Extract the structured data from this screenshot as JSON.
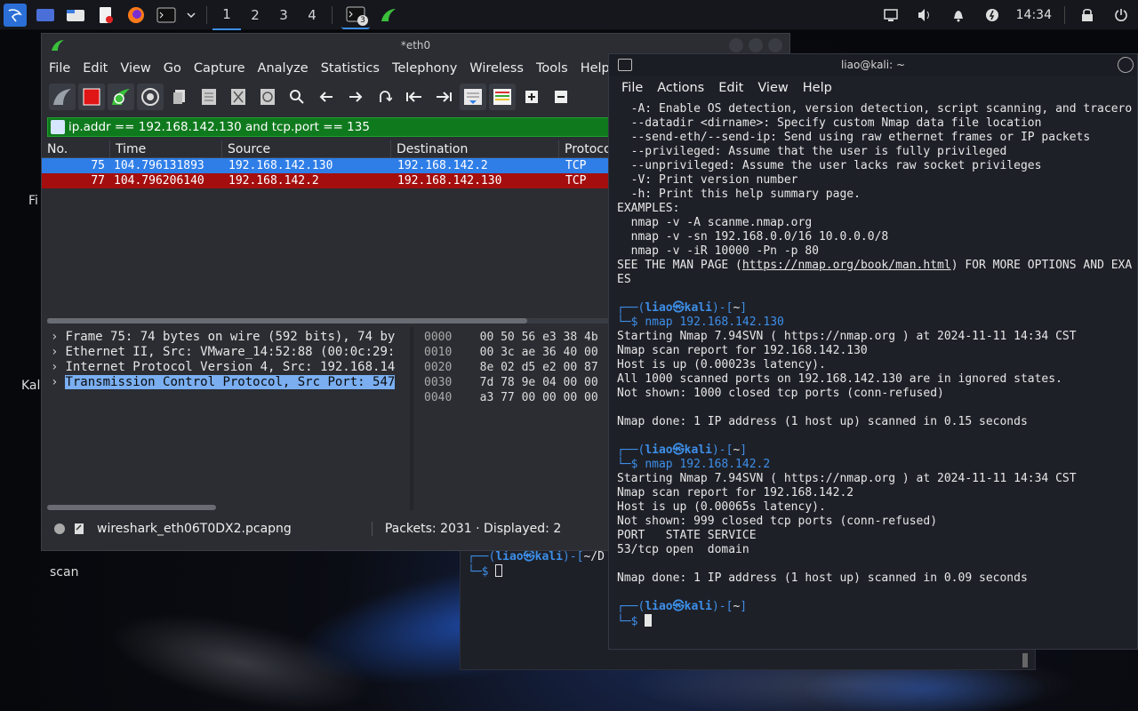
{
  "taskbar": {
    "workspaces": [
      "1",
      "2",
      "3",
      "4"
    ],
    "active_workspace": "1",
    "terminal_badge": "3",
    "clock": "14:34"
  },
  "desktop": {
    "labels": [
      "Fi",
      "Kal",
      "scan"
    ]
  },
  "wireshark": {
    "title": "*eth0",
    "menu": [
      "File",
      "Edit",
      "View",
      "Go",
      "Capture",
      "Analyze",
      "Statistics",
      "Telephony",
      "Wireless",
      "Tools",
      "Help"
    ],
    "filter": "ip.addr == 192.168.142.130 and tcp.port == 135",
    "columns": [
      "No.",
      "Time",
      "Source",
      "Destination",
      "Protocol"
    ],
    "packets": [
      {
        "no": "75",
        "time": "104.796131893",
        "src": "192.168.142.130",
        "dst": "192.168.142.2",
        "proto": "TCP"
      },
      {
        "no": "77",
        "time": "104.796206140",
        "src": "192.168.142.2",
        "dst": "192.168.142.130",
        "proto": "TCP"
      }
    ],
    "tree": [
      "Frame 75: 74 bytes on wire (592 bits), 74 by",
      "Ethernet II, Src: VMware_14:52:88 (00:0c:29:",
      "Internet Protocol Version 4, Src: 192.168.14",
      "Transmission Control Protocol, Src Port: 547"
    ],
    "hex": [
      {
        "off": "0000",
        "bytes": "00 50 56 e3 38 4b"
      },
      {
        "off": "0010",
        "bytes": "00 3c ae 36 40 00"
      },
      {
        "off": "0020",
        "bytes": "8e 02 d5 e2 00 87"
      },
      {
        "off": "0030",
        "bytes": "7d 78 9e 04 00 00"
      },
      {
        "off": "0040",
        "bytes": "a3 77 00 00 00 00"
      }
    ],
    "status_file": "wireshark_eth06T0DX2.pcapng",
    "status_packets": "Packets: 2031 · Displayed: 2"
  },
  "back_terminal": {
    "prompt_user": "liao",
    "prompt_host": "kali",
    "prompt_dir": "~/D"
  },
  "terminal": {
    "title": "liao@kali: ~",
    "menu": [
      "File",
      "Actions",
      "Edit",
      "View",
      "Help"
    ],
    "help_lines": [
      "  -A: Enable OS detection, version detection, script scanning, and tracero",
      "  --datadir <dirname>: Specify custom Nmap data file location",
      "  --send-eth/--send-ip: Send using raw ethernet frames or IP packets",
      "  --privileged: Assume that the user is fully privileged",
      "  --unprivileged: Assume the user lacks raw socket privileges",
      "  -V: Print version number",
      "  -h: Print this help summary page.",
      "EXAMPLES:",
      "  nmap -v -A scanme.nmap.org",
      "  nmap -v -sn 192.168.0.0/16 10.0.0.0/8",
      "  nmap -v -iR 10000 -Pn -p 80"
    ],
    "man_prefix": "SEE THE MAN PAGE (",
    "man_url": "https://nmap.org/book/man.html",
    "man_suffix": ") FOR MORE OPTIONS AND EXA",
    "man_wrap": "ES",
    "prompt_user": "liao",
    "prompt_host": "kali",
    "prompt_dir": "~",
    "cmd1": "nmap 192.168.142.130",
    "out1": [
      "Starting Nmap 7.94SVN ( https://nmap.org ) at 2024-11-11 14:34 CST",
      "Nmap scan report for 192.168.142.130",
      "Host is up (0.00023s latency).",
      "All 1000 scanned ports on 192.168.142.130 are in ignored states.",
      "Not shown: 1000 closed tcp ports (conn-refused)",
      "",
      "Nmap done: 1 IP address (1 host up) scanned in 0.15 seconds"
    ],
    "cmd2": "nmap 192.168.142.2",
    "out2": [
      "Starting Nmap 7.94SVN ( https://nmap.org ) at 2024-11-11 14:34 CST",
      "Nmap scan report for 192.168.142.2",
      "Host is up (0.00065s latency).",
      "Not shown: 999 closed tcp ports (conn-refused)",
      "PORT   STATE SERVICE",
      "53/tcp open  domain",
      "",
      "Nmap done: 1 IP address (1 host up) scanned in 0.09 seconds"
    ]
  }
}
